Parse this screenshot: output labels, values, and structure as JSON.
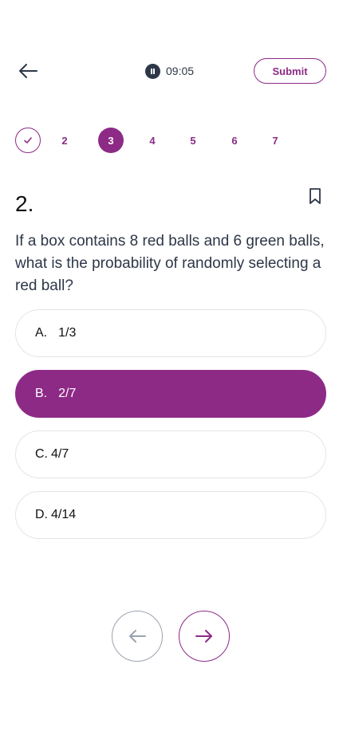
{
  "header": {
    "back_icon": "arrow-left-icon",
    "timer": "09:05",
    "submit_label": "Submit"
  },
  "steps": [
    {
      "label": "",
      "state": "done",
      "icon": "check-icon"
    },
    {
      "label": "2",
      "state": "default"
    },
    {
      "label": "3",
      "state": "active"
    },
    {
      "label": "4",
      "state": "default"
    },
    {
      "label": "5",
      "state": "default"
    },
    {
      "label": "6",
      "state": "default"
    },
    {
      "label": "7",
      "state": "default"
    }
  ],
  "question": {
    "number": "2.",
    "text": "If a box contains 8 red balls and 6 green balls, what is the probability of randomly selecting a red ball?",
    "bookmark_icon": "bookmark-icon"
  },
  "options": [
    {
      "letter": "A.",
      "value": "1/3",
      "selected": false
    },
    {
      "letter": "B.",
      "value": "2/7",
      "selected": true
    },
    {
      "letter": "C.",
      "value": "4/7",
      "selected": false
    },
    {
      "letter": "D.",
      "value": "4/14",
      "selected": false
    }
  ],
  "navigation": {
    "prev_icon": "arrow-left-icon",
    "next_icon": "arrow-right-icon"
  },
  "colors": {
    "accent": "#8d2a86",
    "text": "#2d3748",
    "border": "#e5e5e5"
  }
}
